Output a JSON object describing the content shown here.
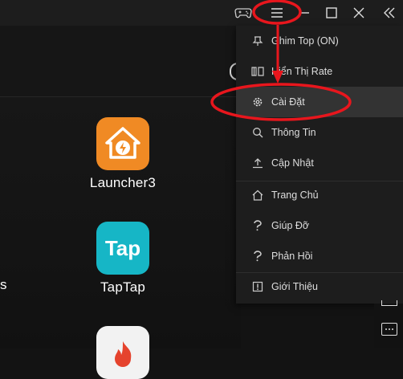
{
  "titlebar": {
    "icons": [
      "gamepad-icon",
      "hamburger-menu-icon",
      "minimize-icon",
      "maximize-icon",
      "close-icon",
      "collapse-sidebar-icon"
    ]
  },
  "apps": [
    {
      "label": "Launcher3",
      "icon": "launcher3-icon",
      "color": "#f08a24"
    },
    {
      "label": "TapTap",
      "icon": "taptap-icon",
      "color": "#16b6c6"
    }
  ],
  "edge_text": "s",
  "menu": {
    "items": [
      {
        "label": "Ghim Top (ON)",
        "icon": "pin-icon"
      },
      {
        "label": "Hiển Thị Rate",
        "icon": "rate-icon"
      },
      {
        "label": "Cài Đặt",
        "icon": "settings-icon",
        "active": true
      },
      {
        "label": "Thông Tin",
        "icon": "search-icon"
      },
      {
        "label": "Cập Nhật",
        "icon": "upload-icon"
      },
      {
        "label": "Trang Chủ",
        "icon": "home-icon"
      },
      {
        "label": "Giúp Đỡ",
        "icon": "help-icon"
      },
      {
        "label": "Phản Hồi",
        "icon": "feedback-icon"
      },
      {
        "label": "Giới Thiệu",
        "icon": "info-icon"
      }
    ]
  },
  "colors": {
    "annotation": "#e8161d",
    "menu_bg": "#1d1d1d",
    "active_bg": "#333333",
    "text": "#dedede"
  }
}
